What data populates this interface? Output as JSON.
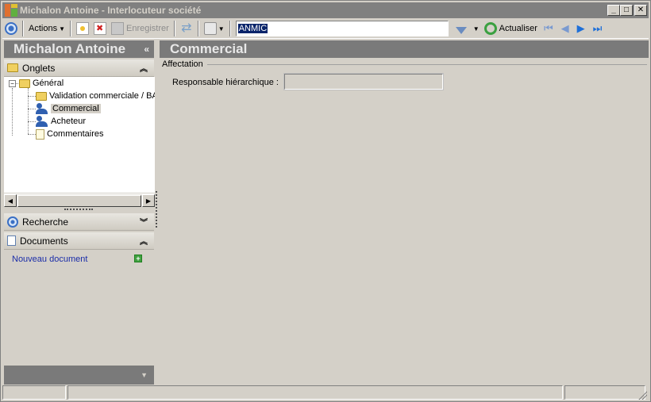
{
  "window": {
    "title": "Michalon Antoine -  Interlocuteur société"
  },
  "toolbar": {
    "actions_label": "Actions",
    "save_label": "Enregistrer",
    "search_value": "ANMIC",
    "refresh_label": "Actualiser"
  },
  "left_panel": {
    "header": "Michalon Antoine",
    "collapse_glyph": "«",
    "sections": {
      "tabs": "Onglets",
      "search": "Recherche",
      "documents": "Documents"
    },
    "tree": {
      "root": "Général",
      "children": [
        "Validation commerciale / BA",
        "Commercial",
        "Acheteur",
        "Commentaires"
      ]
    },
    "new_document_link": "Nouveau document"
  },
  "main": {
    "header": "Commercial",
    "group_title": "Affectation",
    "field_label": "Responsable hiérarchique :",
    "field_value": ""
  }
}
